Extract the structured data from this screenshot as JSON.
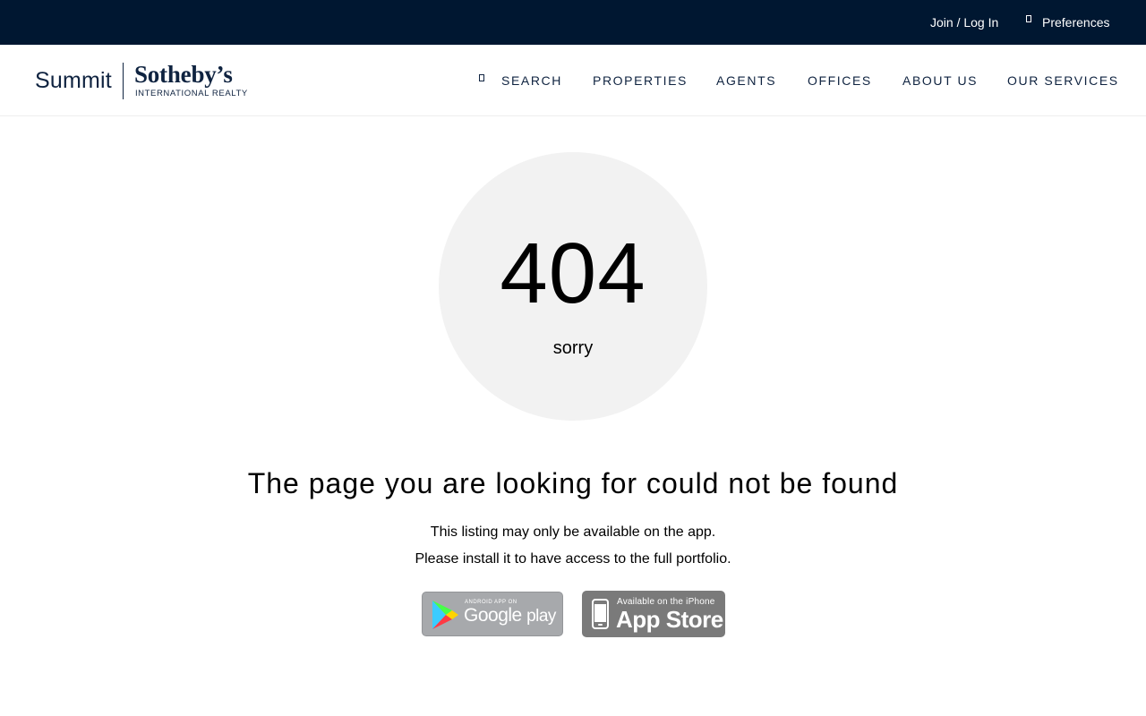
{
  "topbar": {
    "join_label": "Join / Log In",
    "preferences_label": "Preferences",
    "background": "#001731"
  },
  "brand": {
    "summit": "Summit",
    "sothebys": "Sotheby’s",
    "tagline": "INTERNATIONAL REALTY",
    "color": "#0f2340"
  },
  "nav": {
    "items": [
      {
        "label": "SEARCH",
        "icon": "search-icon"
      },
      {
        "label": "PROPERTIES"
      },
      {
        "label": "AGENTS"
      },
      {
        "label": "OFFICES"
      },
      {
        "label": "ABOUT US"
      },
      {
        "label": "OUR SERVICES"
      }
    ]
  },
  "error": {
    "code": "404",
    "sorry": "sorry",
    "headline": "The page you are looking for could not be found",
    "line1": "This listing may only be available on the app.",
    "line2": "Please install it to have access to the full portfolio."
  },
  "badges": {
    "google": {
      "small": "ANDROID APP ON",
      "big_google": "Google",
      "big_play": "play",
      "icon": "google-play-icon"
    },
    "apple": {
      "small": "Available on the iPhone",
      "big": "App Store",
      "icon": "iphone-icon"
    }
  }
}
